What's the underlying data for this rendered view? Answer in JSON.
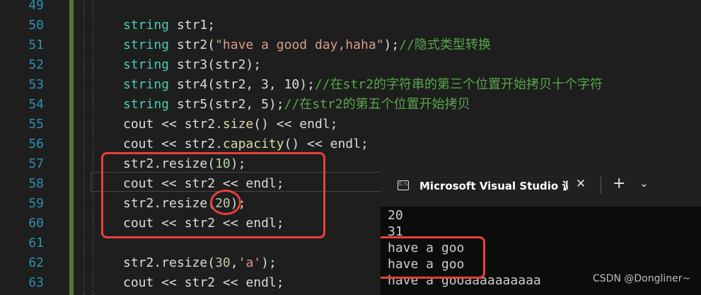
{
  "line_numbers": [
    "49",
    "50",
    "51",
    "52",
    "53",
    "54",
    "55",
    "56",
    "57",
    "58",
    "59",
    "60",
    "61",
    "62",
    "63"
  ],
  "code": {
    "l50": {
      "type": "string",
      "var": "str1",
      "end": ";"
    },
    "l51": {
      "type": "string",
      "var": "str2",
      "open": "(",
      "str": "\"have a good day,haha\"",
      "close": ");",
      "comment": "//隐式类型转换"
    },
    "l52": {
      "type": "string",
      "call": "str3(str2);"
    },
    "l53": {
      "type": "string",
      "call": "str4(str2, 3, 10);",
      "comment": "//在str2的字符串的第三个位置开始拷贝十个字符"
    },
    "l54": {
      "type": "string",
      "call": "str5(str2, 5);",
      "comment": "//在str2的第五个位置开始拷贝"
    },
    "l55": "cout << str2.size() << endl;",
    "l56": "cout << str2.capacity() << endl;",
    "l57": {
      "obj": "str2",
      "dot": ".",
      "fn": "resize",
      "open": "(",
      "num": "10",
      "close": ");"
    },
    "l58": "cout << str2 << endl;",
    "l59": {
      "obj": "str2",
      "dot": ".",
      "fn": "resize",
      "open": "(",
      "num": "20",
      "close": ");"
    },
    "l60": "cout << str2 << endl;",
    "l62": {
      "obj": "str2",
      "dot": ".",
      "fn": "resize",
      "open": "(",
      "num": "30",
      "sep": ",",
      "str": "'a'",
      "close": ");"
    },
    "l63": "cout << str2 << endl;"
  },
  "console": {
    "title": "Microsoft Visual Studio 调试控制台",
    "close_glyph": "✕",
    "add_glyph": "+",
    "menu_glyph": "⌄",
    "icon": "console-icon",
    "output": [
      "20",
      "31",
      "have a goo",
      "have a goo",
      "have a gooaaaaaaaaaa"
    ]
  },
  "watermark": "CSDN @Dongliner~",
  "colors": {
    "highlight": "#e8403a",
    "keyword": "#4ec9b0",
    "line_number": "#2b91af",
    "comment": "#57a64a",
    "string": "#d69d85"
  }
}
